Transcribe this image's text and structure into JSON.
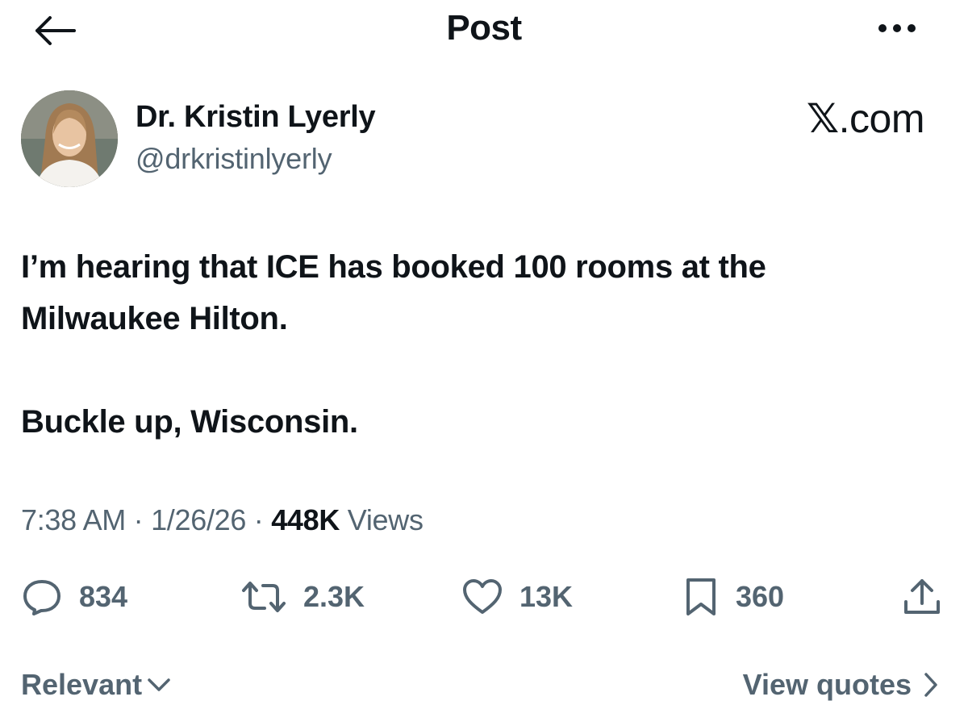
{
  "header": {
    "title": "Post"
  },
  "author": {
    "name": "Dr. Kristin Lyerly",
    "handle": "@drkristinlyerly"
  },
  "brand": {
    "x": "𝕏",
    "suffix": ".com"
  },
  "post": {
    "line1": "I’m hearing that ICE has booked 100 rooms at the",
    "line2": "Milwaukee Hilton.",
    "line3": "Buckle up, Wisconsin."
  },
  "meta": {
    "time": "7:38 AM",
    "sep": " · ",
    "date": "1/26/26",
    "views_count": "448K",
    "views_label": " Views"
  },
  "actions": {
    "replies": "834",
    "reposts": "2.3K",
    "likes": "13K",
    "bookmarks": "360"
  },
  "footer": {
    "sort_label": "Relevant",
    "quotes_label": "View quotes"
  },
  "icons": {
    "back": "arrow-left-icon",
    "more": "more-icon",
    "reply": "reply-icon",
    "repost": "repost-icon",
    "like": "heart-icon",
    "bookmark": "bookmark-icon",
    "share": "share-icon"
  },
  "colors": {
    "text": "#0f1419",
    "secondary": "#536471",
    "background": "#ffffff"
  }
}
